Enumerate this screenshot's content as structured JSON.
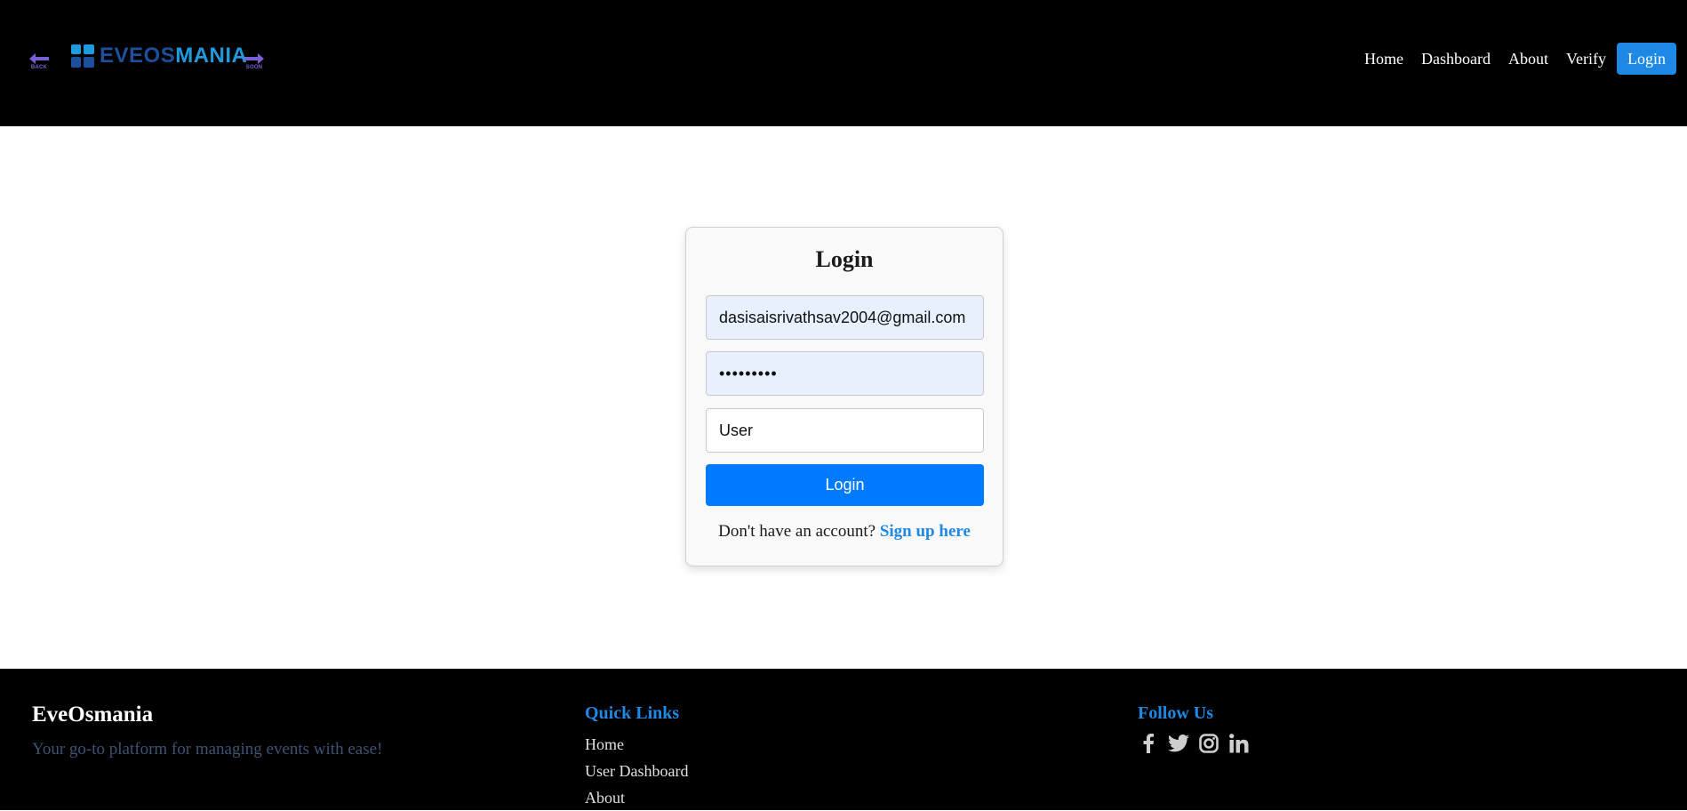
{
  "header": {
    "back_caption": "BACK",
    "soon_caption": "SOON",
    "brand": {
      "part1": "EVEOS",
      "part2": "MANIA",
      "color_part1": "#1c4f9c",
      "color_part2": "#1e9be0"
    },
    "nav": {
      "home": "Home",
      "dashboard": "Dashboard",
      "about": "About",
      "verify": "Verify",
      "login": "Login"
    },
    "icons": {
      "back": "arrow-left-icon",
      "soon": "arrow-right-icon",
      "brand": "grid-logo-icon"
    }
  },
  "login_form": {
    "title": "Login",
    "email_value": "dasisaisrivathsav2004@gmail.com",
    "password_value": "•••••••••",
    "role_options": [
      "User"
    ],
    "role_selected": "User",
    "submit_label": "Login",
    "signup_prompt": "Don't have an account?",
    "signup_link": "Sign up here"
  },
  "footer": {
    "brand": "EveOsmania",
    "tagline": "Your go-to platform for managing events with ease!",
    "quick_links_heading": "Quick Links",
    "quick_links": [
      "Home",
      "User Dashboard",
      "About"
    ],
    "follow_heading": "Follow Us",
    "social_icons": [
      "facebook-icon",
      "twitter-icon",
      "instagram-icon",
      "linkedin-icon"
    ]
  },
  "colors": {
    "header_bg": "#000000",
    "accent": "#1e88e5",
    "submit_button": "#007bff",
    "autofill_bg": "#e8f0fe",
    "tagline": "#3e5272"
  }
}
